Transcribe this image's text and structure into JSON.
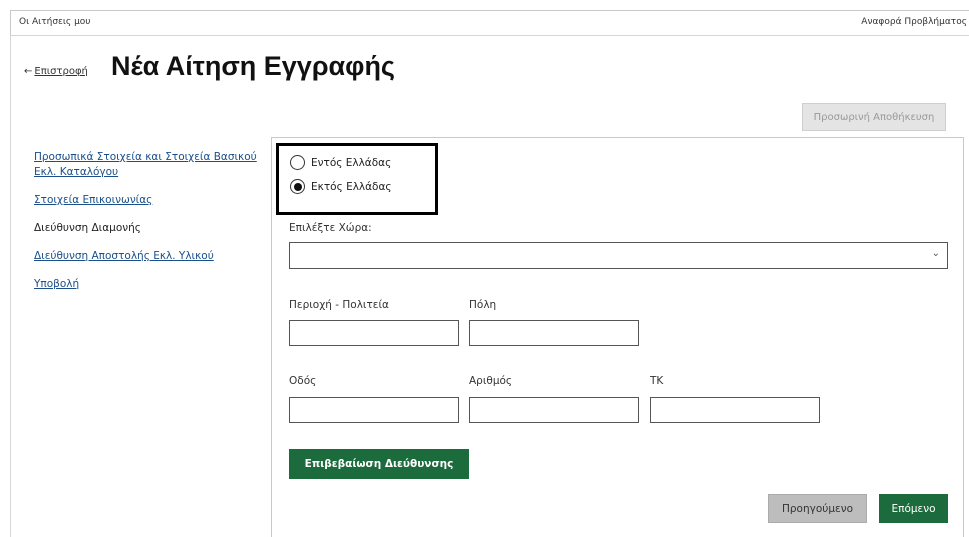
{
  "topbar": {
    "left_text": "Οι Αιτήσεις μου",
    "right_text": "Αναφορά Προβλήματος"
  },
  "header": {
    "back_arrow": "←",
    "back_label": "Επιστροφή",
    "title": "Νέα Αίτηση Εγγραφής",
    "save_label": "Προσωρινή Αποθήκευση"
  },
  "sidebar": {
    "items": [
      {
        "label": "Προσωπικά Στοιχεία και Στοιχεία Βασικού Εκλ. Καταλόγου"
      },
      {
        "label": "Στοιχεία Επικοινωνίας"
      },
      {
        "label": "Διεύθυνση Διαμονής"
      },
      {
        "label": "Διεύθυνση Αποστολής Εκλ. Υλικού"
      },
      {
        "label": "Υποβολή"
      }
    ]
  },
  "form": {
    "location_options": [
      {
        "label": "Εντός Ελλάδας",
        "selected": false
      },
      {
        "label": "Εκτός Ελλάδας",
        "selected": true
      }
    ],
    "country_label": "Επιλέξτε Χώρα:",
    "country_value": "",
    "region_label": "Περιοχή - Πολιτεία",
    "region_value": "",
    "city_label": "Πόλη",
    "city_value": "",
    "street_label": "Οδός",
    "street_value": "",
    "number_label": "Αριθμός",
    "number_value": "",
    "postal_label": "ΤΚ",
    "postal_value": "",
    "confirm_label": "Επιβεβαίωση Διεύθυνσης",
    "prev_label": "Προηγούμενο",
    "next_label": "Επόμενο"
  },
  "colors": {
    "primary_green": "#1c6b3c",
    "link_blue": "#1a4f8a",
    "disabled_gray": "#bdbdbd"
  },
  "icons": {
    "back": "arrow-left-icon",
    "select": "chevron-down-icon"
  }
}
